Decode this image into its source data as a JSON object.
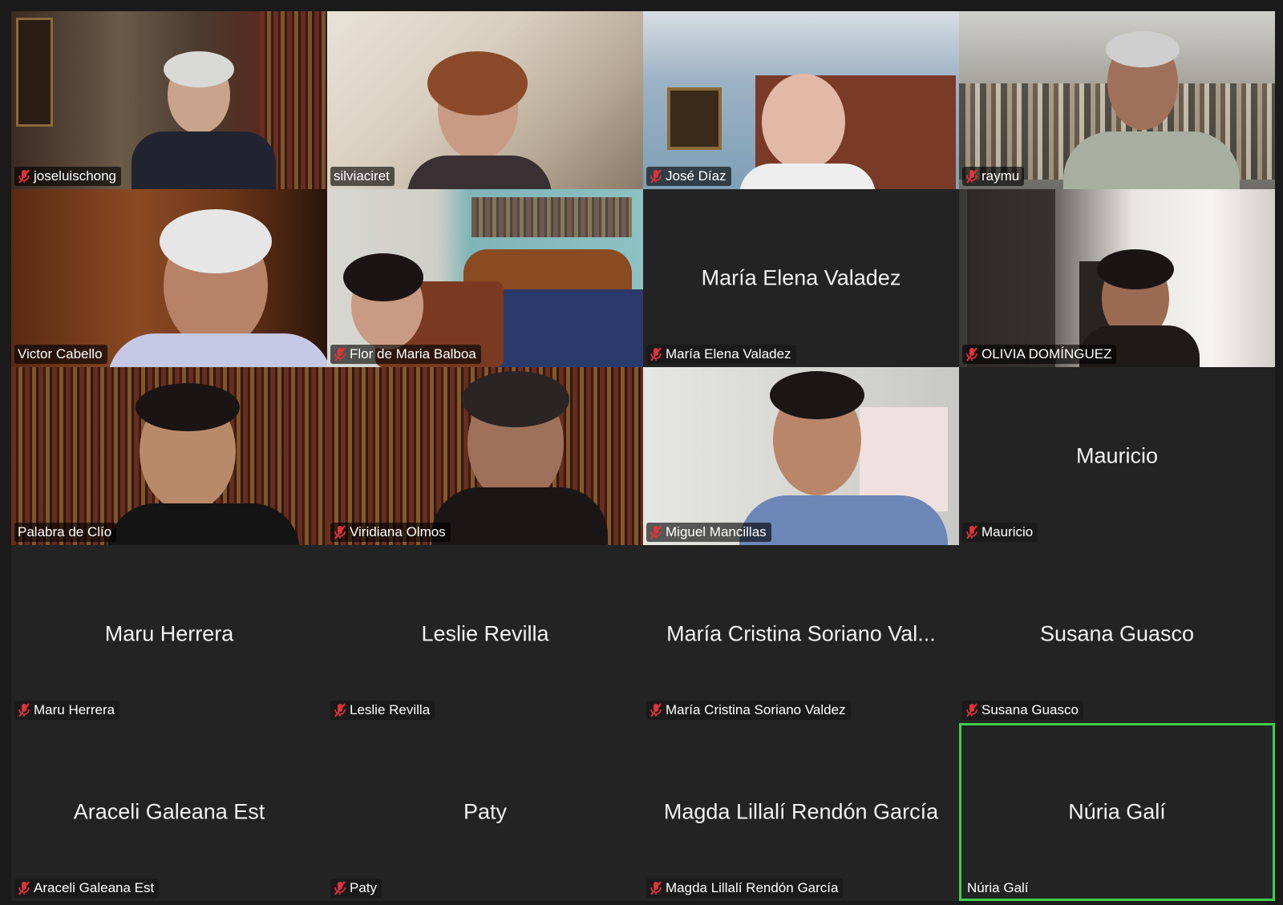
{
  "meeting": {
    "active_speaker_color": "#3ecf4c",
    "mic_muted_color": "#e0333a"
  },
  "participants": [
    {
      "display": "joseluischong",
      "muted": true,
      "video": true,
      "scene": "study"
    },
    {
      "display": "silviaciret",
      "muted": false,
      "video": true,
      "scene": "bright"
    },
    {
      "display": "José Díaz",
      "muted": true,
      "video": true,
      "scene": "blue-wall"
    },
    {
      "display": "raymu",
      "muted": true,
      "video": true,
      "scene": "bookshelf-grey"
    },
    {
      "display": "Victor Cabello",
      "muted": false,
      "video": true,
      "scene": "warm-wood"
    },
    {
      "display": "Flor de Maria Balboa",
      "muted": true,
      "video": true,
      "scene": "bedroom"
    },
    {
      "display": "María Elena Valadez",
      "center": "María Elena Valadez",
      "muted": true,
      "video": false
    },
    {
      "display": "OLIVIA DOMÍNGUEZ",
      "muted": true,
      "video": true,
      "scene": "hallway"
    },
    {
      "display": "Palabra de Clío",
      "muted": false,
      "video": true,
      "scene": "library"
    },
    {
      "display": "Viridiana Olmos",
      "muted": true,
      "video": true,
      "scene": "library2"
    },
    {
      "display": "Miguel Mancillas",
      "muted": true,
      "video": true,
      "scene": "office"
    },
    {
      "display": "Mauricio",
      "center": "Mauricio",
      "muted": true,
      "video": false
    },
    {
      "display": "Maru Herrera",
      "center": "Maru Herrera",
      "muted": true,
      "video": false
    },
    {
      "display": "Leslie Revilla",
      "center": "Leslie Revilla",
      "muted": true,
      "video": false
    },
    {
      "display": "María Cristina Soriano Valdez",
      "center": "María Cristina Soriano Val...",
      "muted": true,
      "video": false
    },
    {
      "display": "Susana Guasco",
      "center": "Susana Guasco",
      "muted": true,
      "video": false
    },
    {
      "display": "Araceli Galeana Est",
      "center": "Araceli Galeana Est",
      "muted": true,
      "video": false
    },
    {
      "display": "Paty",
      "center": "Paty",
      "muted": true,
      "video": false
    },
    {
      "display": "Magda Lillalí Rendón García",
      "center": "Magda Lillalí Rendón García",
      "muted": true,
      "video": false
    },
    {
      "display": "Núria Galí",
      "center": "Núria Galí",
      "muted": false,
      "video": false,
      "active": true
    }
  ]
}
